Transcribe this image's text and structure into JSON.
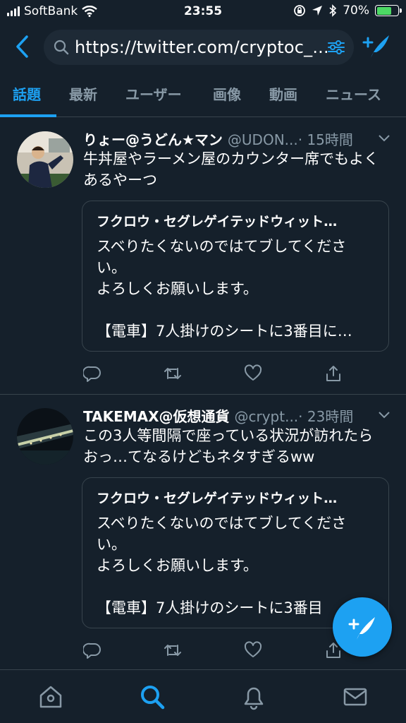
{
  "status_bar": {
    "carrier": "SoftBank",
    "time": "23:55",
    "battery": "70%",
    "battery_level": 0.7
  },
  "search": {
    "url": "https://twitter.com/cryptoc_..."
  },
  "tabs": [
    {
      "label": "話題",
      "active": true
    },
    {
      "label": "最新",
      "active": false
    },
    {
      "label": "ユーザー",
      "active": false
    },
    {
      "label": "画像",
      "active": false
    },
    {
      "label": "動画",
      "active": false
    },
    {
      "label": "ニュース",
      "active": false
    }
  ],
  "tweets": [
    {
      "name": "りょー@うどん★マン",
      "handle": "@UDON...",
      "time": "· 15時間",
      "text": "牛丼屋やラーメン屋のカウンター席でもよくあるやーつ",
      "quote": {
        "name": "フクロウ・セグレゲイテッドウィット…",
        "text": "スベりたくないのではてブしてください。\nよろしくお願いします。\n\n【電車】7人掛けのシートに3番目に…"
      }
    },
    {
      "name": "TAKEMAX@仮想通貨",
      "handle": "@crypt...",
      "time": "· 23時間",
      "text": "この3人等間隔で座っている状況が訪れたらおっ…てなるけどもネタすぎるww",
      "quote": {
        "name": "フクロウ・セグレゲイテッドウィット…",
        "text": "スベりたくないのではてブしてください。\nよろしくお願いします。\n\n【電車】7人掛けのシートに3番目"
      }
    }
  ],
  "colors": {
    "background": "#15202b",
    "accent": "#1da1f2",
    "secondary_text": "#8899a6",
    "border": "#38444d"
  },
  "icons": {
    "back": "chevron-left-icon",
    "search": "search-icon",
    "filter": "sliders-icon",
    "compose": "compose-tweet-icon",
    "reply": "reply-icon",
    "retweet": "retweet-icon",
    "like": "heart-icon",
    "share": "share-icon",
    "home": "home-icon",
    "explore": "search-icon",
    "notifications": "bell-icon",
    "messages": "mail-icon"
  }
}
